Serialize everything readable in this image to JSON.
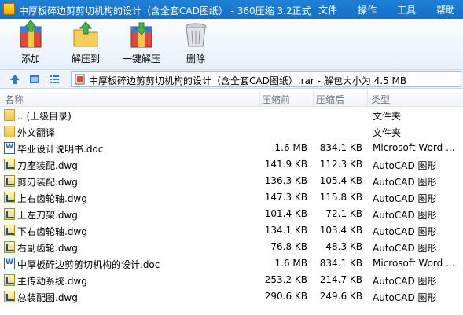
{
  "window": {
    "title": "中厚板碎边剪剪切机构的设计（含全套CAD图纸） - 360压缩 3.2正式",
    "menu": [
      "文件",
      "操作",
      "工具",
      "帮助"
    ]
  },
  "toolbar": {
    "add": "添加",
    "extract_to": "解压到",
    "one_click_extract": "一键解压",
    "delete": "删除"
  },
  "address": {
    "path": "中厚板碎边剪剪切机构的设计（含全套CAD图纸）.rar - 解包大小为 4.5 MB"
  },
  "columns": {
    "name": "名称",
    "compressed_before": "压缩前",
    "compressed_after": "压缩后",
    "type": "类型"
  },
  "files": [
    {
      "name": ".. (上级目录)",
      "before": "",
      "after": "",
      "type": "文件夹",
      "icon": "folder-icon"
    },
    {
      "name": "外文翻译",
      "before": "",
      "after": "",
      "type": "文件夹",
      "icon": "folder-icon"
    },
    {
      "name": "毕业设计说明书.doc",
      "before": "1.6 MB",
      "after": "834.1 KB",
      "type": "Microsoft Word ...",
      "icon": "word-doc-icon"
    },
    {
      "name": "刀座装配.dwg",
      "before": "141.9 KB",
      "after": "112.3 KB",
      "type": "AutoCAD 图形",
      "icon": "autocad-dwg-icon"
    },
    {
      "name": "剪刃装配.dwg",
      "before": "136.3 KB",
      "after": "105.4 KB",
      "type": "AutoCAD 图形",
      "icon": "autocad-dwg-icon"
    },
    {
      "name": "上右齿轮轴.dwg",
      "before": "147.3 KB",
      "after": "115.8 KB",
      "type": "AutoCAD 图形",
      "icon": "autocad-dwg-icon"
    },
    {
      "name": "上左刀架.dwg",
      "before": "101.4 KB",
      "after": "72.1 KB",
      "type": "AutoCAD 图形",
      "icon": "autocad-dwg-icon"
    },
    {
      "name": "下右齿轮轴.dwg",
      "before": "134.1 KB",
      "after": "103.4 KB",
      "type": "AutoCAD 图形",
      "icon": "autocad-dwg-icon"
    },
    {
      "name": "右副齿轮.dwg",
      "before": "76.8 KB",
      "after": "48.3 KB",
      "type": "AutoCAD 图形",
      "icon": "autocad-dwg-icon"
    },
    {
      "name": "中厚板碎边剪剪切机构的设计.doc",
      "before": "1.6 MB",
      "after": "834.1 KB",
      "type": "Microsoft Word ...",
      "icon": "word-doc-icon"
    },
    {
      "name": "主传动系统.dwg",
      "before": "253.2 KB",
      "after": "214.7 KB",
      "type": "AutoCAD 图形",
      "icon": "autocad-dwg-icon"
    },
    {
      "name": "总装配图.dwg",
      "before": "290.6 KB",
      "after": "249.6 KB",
      "type": "AutoCAD 图形",
      "icon": "autocad-dwg-icon"
    }
  ]
}
